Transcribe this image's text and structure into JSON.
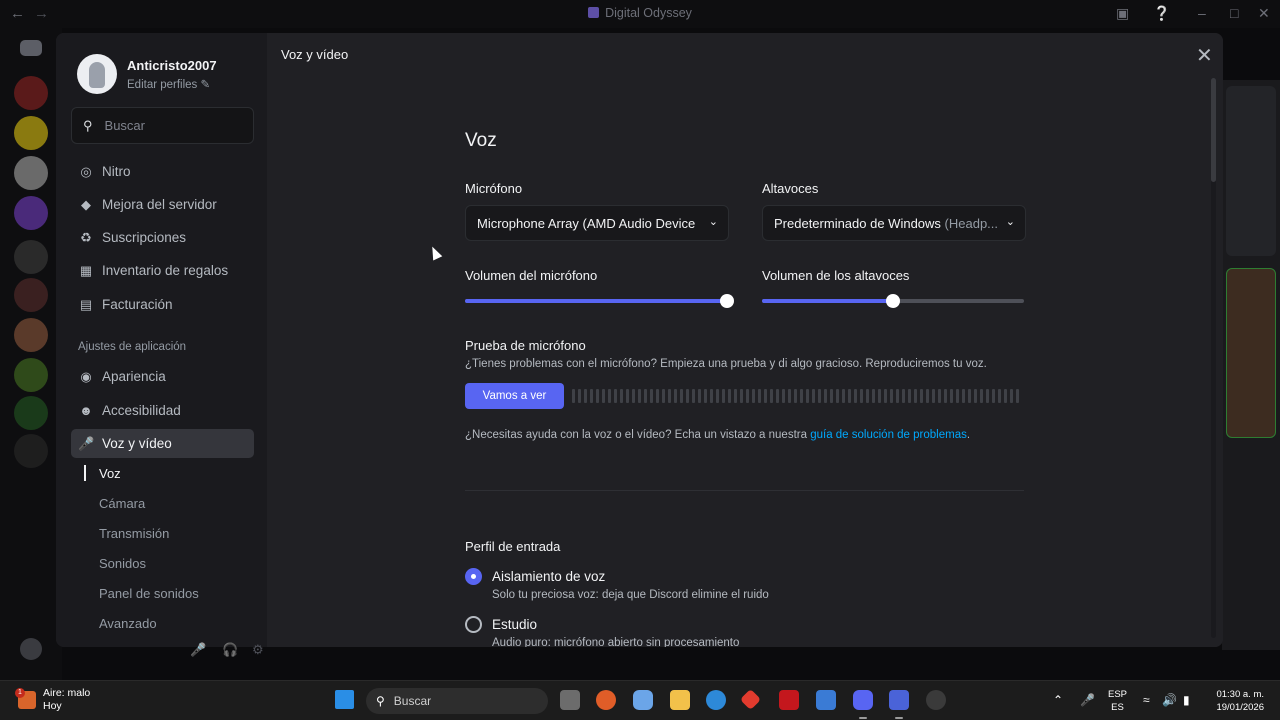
{
  "window": {
    "title": "Digital Odyssey"
  },
  "profile": {
    "username": "Anticristo2007",
    "edit_label": "Editar perfiles"
  },
  "search": {
    "placeholder": "Buscar"
  },
  "nav": {
    "items": [
      {
        "label": "Nitro",
        "icon": "nitro-icon"
      },
      {
        "label": "Mejora del servidor",
        "icon": "boost-icon"
      },
      {
        "label": "Suscripciones",
        "icon": "subscriptions-icon"
      },
      {
        "label": "Inventario de regalos",
        "icon": "gift-icon"
      },
      {
        "label": "Facturación",
        "icon": "billing-icon"
      }
    ],
    "section_app": "Ajustes de aplicación",
    "app_items": [
      {
        "label": "Apariencia",
        "icon": "palette-icon"
      },
      {
        "label": "Accesibilidad",
        "icon": "accessibility-icon"
      },
      {
        "label": "Voz y vídeo",
        "icon": "microphone-icon"
      }
    ],
    "sub_items": [
      "Voz",
      "Cámara",
      "Transmisión",
      "Sonidos",
      "Panel de sonidos",
      "Avanzado"
    ]
  },
  "content": {
    "header": "Voz y vídeo",
    "section_title": "Voz",
    "microphone": {
      "label": "Micrófono",
      "value": "Microphone Array (AMD Audio Device"
    },
    "speakers": {
      "label": "Altavoces",
      "value": "Predeterminado de Windows",
      "value_dim": "(Headp..."
    },
    "mic_volume": {
      "label": "Volumen del micrófono",
      "percent": 100
    },
    "speaker_volume": {
      "label": "Volumen de los altavoces",
      "percent": 50
    },
    "mic_test": {
      "title": "Prueba de micrófono",
      "description": "¿Tienes problemas con el micrófono? Empieza una prueba y di algo gracioso. Reproduciremos tu voz.",
      "button": "Vamos a ver"
    },
    "help": {
      "text": "¿Necesitas ayuda con la voz o el vídeo? Echa un vistazo a nuestra ",
      "link": "guía de solución de problemas",
      "end": "."
    },
    "input_profile": {
      "title": "Perfil de entrada",
      "options": [
        {
          "title": "Aislamiento de voz",
          "subtitle": "Solo tu preciosa voz: deja que Discord elimine el ruido",
          "selected": true
        },
        {
          "title": "Estudio",
          "subtitle": "Audio puro: micrófono abierto sin procesamiento",
          "selected": false
        }
      ]
    }
  },
  "taskbar": {
    "weather_line1": "Aire: malo",
    "weather_line2": "Hoy",
    "weather_badge": "1",
    "search_placeholder": "Buscar",
    "lang_line1": "ESP",
    "lang_line2": "ES",
    "time": "01:30 a. m.",
    "date": "19/01/2026"
  },
  "colors": {
    "accent": "#5865f2",
    "link": "#00a8fc",
    "modal_bg": "#202024",
    "sidebar_bg": "#1a1a1e"
  }
}
